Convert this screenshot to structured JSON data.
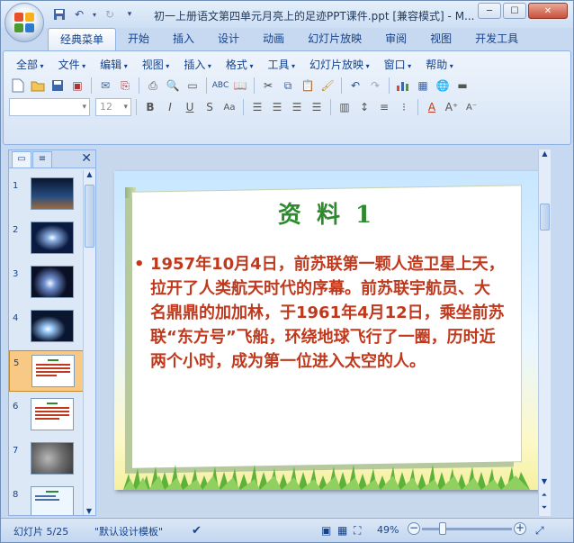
{
  "window": {
    "title": "初一上册语文第四单元月亮上的足迹PPT课件.ppt [兼容模式] - M...",
    "min_label": "─",
    "max_label": "☐",
    "close_label": "✕"
  },
  "ribbon": {
    "tabs": [
      {
        "label": "经典菜单"
      },
      {
        "label": "开始"
      },
      {
        "label": "插入"
      },
      {
        "label": "设计"
      },
      {
        "label": "动画"
      },
      {
        "label": "幻灯片放映"
      },
      {
        "label": "审阅"
      },
      {
        "label": "视图"
      },
      {
        "label": "开发工具"
      }
    ],
    "menus": [
      {
        "label": "全部"
      },
      {
        "label": "文件"
      },
      {
        "label": "编辑"
      },
      {
        "label": "视图"
      },
      {
        "label": "插入"
      },
      {
        "label": "格式"
      },
      {
        "label": "工具"
      },
      {
        "label": "幻灯片放映"
      },
      {
        "label": "窗口"
      },
      {
        "label": "帮助"
      }
    ],
    "font_size_value": "12",
    "bold": "B",
    "italic": "I",
    "underline": "U",
    "strike": "S",
    "charspacing": "Aa"
  },
  "slides_pane": {
    "thumbnails": [
      {
        "number": "1"
      },
      {
        "number": "2"
      },
      {
        "number": "3"
      },
      {
        "number": "4"
      },
      {
        "number": "5"
      },
      {
        "number": "6"
      },
      {
        "number": "7"
      },
      {
        "number": "8"
      }
    ],
    "selected_index": 5
  },
  "slide": {
    "title": "资 料 1",
    "body": "1957年10月4日，前苏联第一颗人造卫星上天，拉开了人类航天时代的序幕。前苏联宇航员、大名鼎鼎的加加林，于1961年4月12日，乘坐前苏联“东方号”飞船，环绕地球飞行了一圈，历时近两个小时，成为第一位进入太空的人。",
    "bullet": "•"
  },
  "status": {
    "slide_info": "幻灯片 5/25",
    "template": "\"默认设计模板\"",
    "zoom": "49%",
    "zoom_minus": "−",
    "zoom_plus": "+"
  },
  "colors": {
    "title_green": "#2f8a2f",
    "body_red": "#c0391d",
    "selection": "#f7c985"
  }
}
